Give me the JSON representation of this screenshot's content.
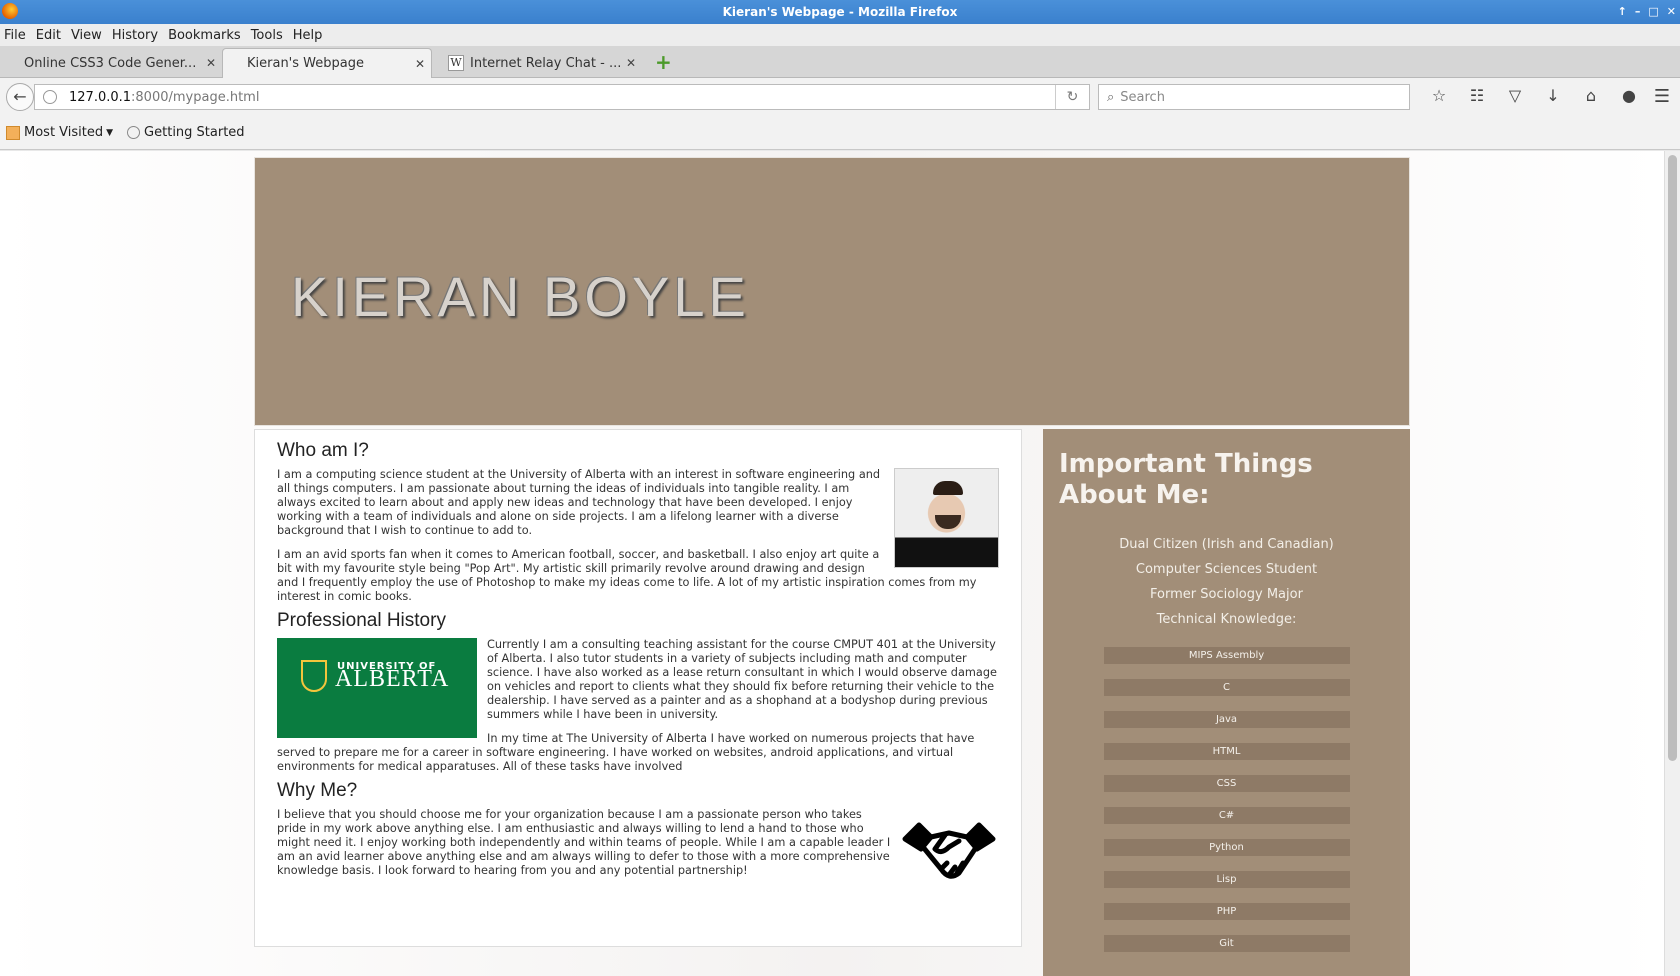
{
  "window": {
    "title": "Kieran's Webpage - Mozilla Firefox"
  },
  "menu": [
    "File",
    "Edit",
    "View",
    "History",
    "Bookmarks",
    "Tools",
    "Help"
  ],
  "tabs": [
    {
      "label": "Online CSS3 Code Gener...",
      "active": false
    },
    {
      "label": "Kieran's Webpage",
      "active": true
    },
    {
      "label": "Internet Relay Chat - ...",
      "active": false
    }
  ],
  "url": {
    "host": "127.0.0.1",
    "path": ":8000/mypage.html"
  },
  "search": {
    "placeholder": "Search"
  },
  "bookmarks": {
    "most_visited": "Most Visited",
    "getting_started": "Getting Started"
  },
  "page": {
    "name": "KIERAN BOYLE",
    "who": {
      "heading": "Who am I?",
      "p1": "I am a computing science student at the University of Alberta with an interest in software engineering and all things computers. I am passionate about turning the ideas of individuals into tangible reality. I am always excited to learn about and apply new ideas and technology that have been developed. I enjoy working with a team of individuals and alone on side projects. I am a lifelong learner with a diverse background that I wish to continue to add to.",
      "p2": "I am an avid sports fan when it comes to American football, soccer, and basketball. I also enjoy art quite a bit with my favourite style being \"Pop Art\". My artistic skill primarily revolve around drawing and design and I frequently employ the use of Photoshop to make my ideas come to life. A lot of my artistic inspiration comes from my interest in comic books."
    },
    "history": {
      "heading": "Professional History",
      "logo_top": "UNIVERSITY OF",
      "logo_bottom": "ALBERTA",
      "p1": "Currently I am a consulting teaching assistant for the course CMPUT 401 at the University of Alberta. I also tutor students in a variety of subjects including math and computer science. I have also worked as a lease return consultant in which I would observe damage on vehicles and report to clients what they should fix before returning their vehicle to the dealership. I have served as a painter and as a shophand at a bodyshop during previous summers while I have been in university.",
      "p2": "In my time at The University of Alberta I have worked on numerous projects that have served to prepare me for a career in software engineering. I have worked on websites, android applications, and virtual environments for medical apparatuses. All of these tasks have involved"
    },
    "why": {
      "heading": "Why Me?",
      "p1": "I believe that you should choose me for your organization because I am a passionate person who takes pride in my work above anything else. I am enthusiastic and always willing to lend a hand to those who might need it. I enjoy working both independently and within teams of people. While I am a capable leader I am an avid learner above anything else and am always willing to defer to those with a more comprehensive knowledge basis. I look forward to hearing from you and any potential partnership!"
    },
    "sidebar": {
      "heading": "Important Things About Me:",
      "facts": [
        "Dual Citizen (Irish and Canadian)",
        "Computer Sciences Student",
        "Former Sociology Major",
        "Technical Knowledge:"
      ],
      "skills": [
        "MIPS Assembly",
        "C",
        "Java",
        "HTML",
        "CSS",
        "C#",
        "Python",
        "Lisp",
        "PHP",
        "Git"
      ]
    }
  }
}
